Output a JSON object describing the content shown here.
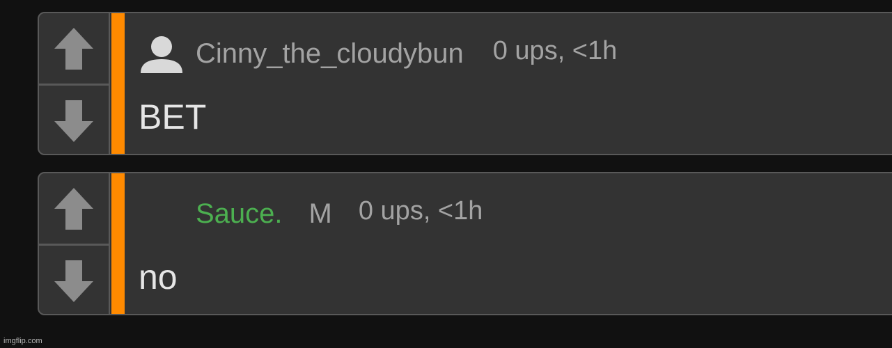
{
  "colors": {
    "background": "#111111",
    "card": "#333333",
    "border": "#595959",
    "accent_bar": "#ff8a00",
    "mod_username": "#4cb050",
    "muted_text": "#a3a3a3",
    "body_text": "#e6e6e6",
    "arrow": "#8c8c8c"
  },
  "comments": [
    {
      "username": "Cinny_the_cloudybun",
      "has_avatar": true,
      "avatar_icon": "user-silhouette-icon",
      "meta": "0 ups, <1h",
      "text": "BET"
    },
    {
      "username": "Sauce.",
      "has_avatar": false,
      "badge": "M",
      "meta": "0 ups, <1h",
      "text": "no"
    }
  ],
  "icons": {
    "upvote": "arrow-up-icon",
    "downvote": "arrow-down-icon"
  },
  "watermark": "imgflip.com"
}
